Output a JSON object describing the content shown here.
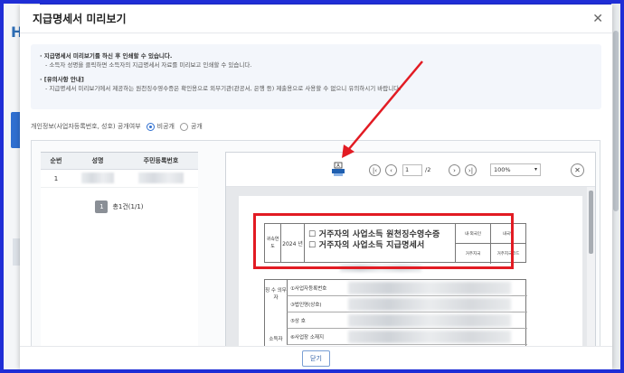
{
  "modal": {
    "title": "지급명세서 미리보기",
    "close_glyph": "✕"
  },
  "notice": {
    "line1": "· 지급명세서 미리보기를 하신 후 인쇄할 수 있습니다.",
    "line2": "- 소득자 성명을 클릭하면 소득자의 지급명세서 자료를 미리보고 인쇄할 수 있습니다.",
    "line3": "· [유의사항 안내]",
    "line4": "- 지급명세서 미리보기에서 제공하는 원천징수영수증은 확인용으로 외부기관(관공서, 은행 등) 제출용으로 사용할 수 없으니 유의하시기 바랍니다."
  },
  "privacy": {
    "label": "개인정보(사업자등록번호, 성호) 공개여부",
    "option_private": "비공개",
    "option_public": "공개",
    "selected": "비공개"
  },
  "grid": {
    "headers": [
      "순번",
      "성명",
      "주민등록번호"
    ],
    "rows": [
      {
        "no": "1"
      }
    ],
    "pager_page": "1",
    "pager_total": "총1건(1/1)"
  },
  "viewer": {
    "page_current": "1",
    "page_total": "/2",
    "zoom": "100%",
    "nav_first": "|‹",
    "nav_prev": "‹",
    "nav_next": "›",
    "nav_last": "›|",
    "close_glyph": "✕"
  },
  "document": {
    "cell_a": "귀속연도",
    "year": "2024 년",
    "title_line1": "☐ 거주자의 사업소득 원천징수영수증",
    "title_line2": "☐ 거주자의 사업소득 지급명세서",
    "side_top_left": "내·외국인",
    "side_top_right": "내국인",
    "side_bottom_left": "거주지국",
    "side_bottom_right": "거주지국코드",
    "section_payer": "징 수 의무자",
    "section_earner": "소득자",
    "row1": "①사업자등록번호",
    "row2": "③법인명(상호)",
    "row3": "⑤상 호",
    "row4": "⑥사업장 소재지"
  },
  "footer": {
    "close_label": "닫기"
  },
  "colors": {
    "frame": "#1f2ed6",
    "highlight": "#e21b23",
    "accent": "#2f6fd0"
  }
}
